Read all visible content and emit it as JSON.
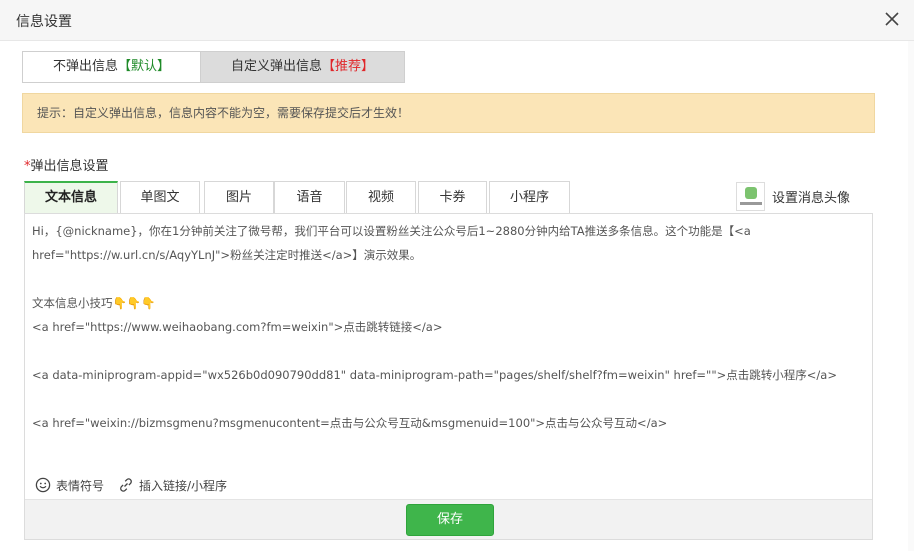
{
  "dialog": {
    "title": "信息设置"
  },
  "mode_switch": {
    "option1_text": "不弹出信息",
    "option1_tag": "【默认】",
    "option2_text": "自定义弹出信息",
    "option2_tag": "【推荐】"
  },
  "notice": {
    "text": "提示：自定义弹出信息，信息内容不能为空，需要保存提交后才生效！"
  },
  "section": {
    "required_mark": "*",
    "label": "弹出信息设置"
  },
  "tabs": [
    "文本信息",
    "单图文",
    "图片",
    "语音",
    "视频",
    "卡券",
    "小程序"
  ],
  "avatar_setting": {
    "label": "设置消息头像"
  },
  "editor": {
    "lines": [
      "Hi，{@nickname}，你在1分钟前关注了微号帮，我们平台可以设置粉丝关注公众号后1~2880分钟内给TA推送多条信息。这个功能是【<a",
      "href=\"https://w.url.cn/s/AqyYLnJ\">粉丝关注定时推送</a>】演示效果。",
      "",
      "文本信息小技巧",
      "<a href=\"https://www.weihaobang.com?fm=weixin\">点击跳转链接</a>",
      "",
      "<a data-miniprogram-appid=\"wx526b0d090790dd81\" data-miniprogram-path=\"pages/shelf/shelf?fm=weixin\" href=\"\">点击跳转小程序</a>",
      "",
      "<a href=\"weixin://bizmsgmenu?msgmenucontent=点击与公众号互动&msgmenuid=100\">点击与公众号互动</a>"
    ],
    "tip_emoji": "👇👇👇"
  },
  "tools": {
    "emoji_label": "表情符号",
    "link_label": "插入链接/小程序"
  },
  "footer": {
    "save_label": "保存"
  },
  "colors": {
    "accent_green": "#3fb54b",
    "tag_green": "#1e8a28",
    "tag_red": "#e0262a",
    "notice_bg": "#fbe5b7"
  }
}
